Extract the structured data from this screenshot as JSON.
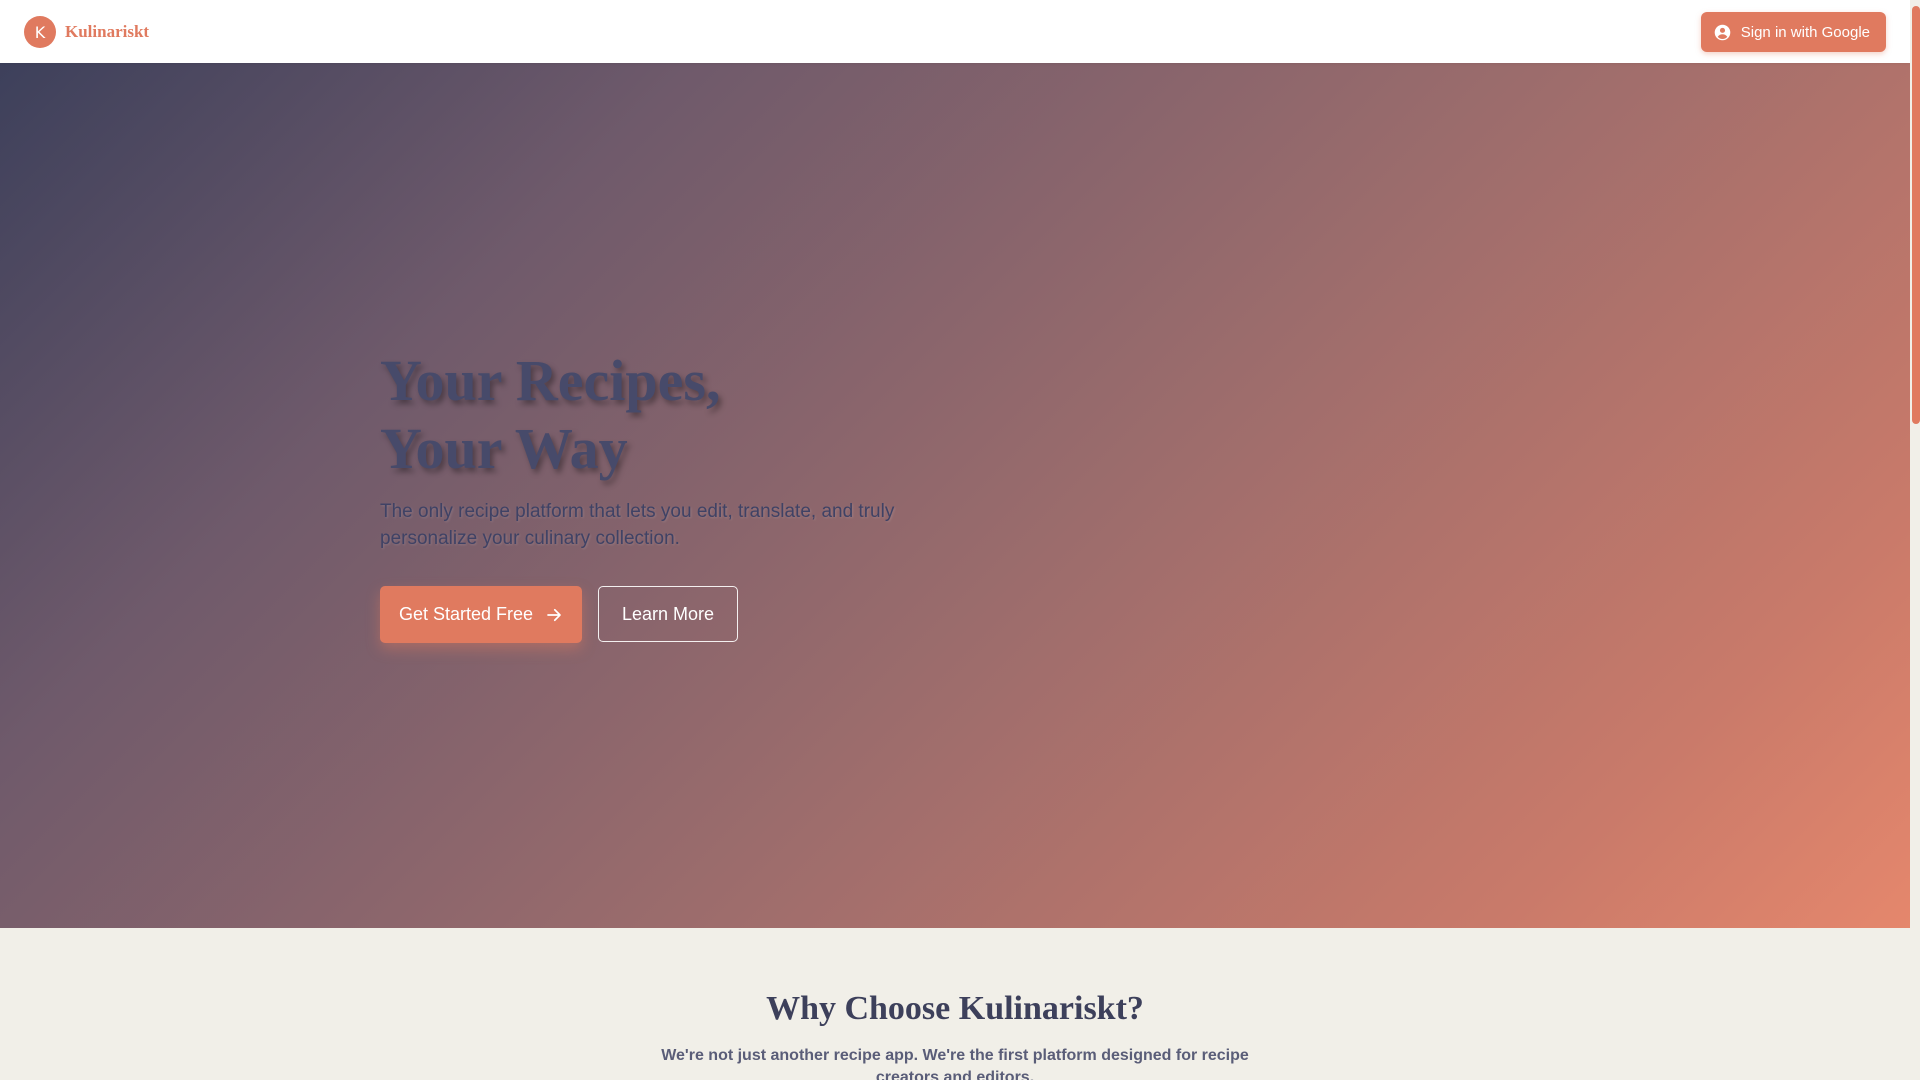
{
  "header": {
    "brand_letter": "K",
    "brand_name": "Kulinariskt",
    "signin_label": "Sign in with Google",
    "signin_icon": "account-circle-icon"
  },
  "hero": {
    "title_line1": "Your Recipes,",
    "title_line2": "Your Way",
    "subtitle": "The only recipe platform that lets you edit, translate, and truly personalize your culinary collection.",
    "primary_label": "Get Started Free",
    "primary_icon": "arrow-right-icon",
    "secondary_label": "Learn More"
  },
  "features": {
    "title": "Why Choose Kulinariskt?",
    "subtitle": "We're not just another recipe app. We're the first platform designed for recipe creators and editors."
  },
  "colors": {
    "accent": "#e07a5f",
    "navy": "#3d405b",
    "background": "#f1efe8"
  }
}
